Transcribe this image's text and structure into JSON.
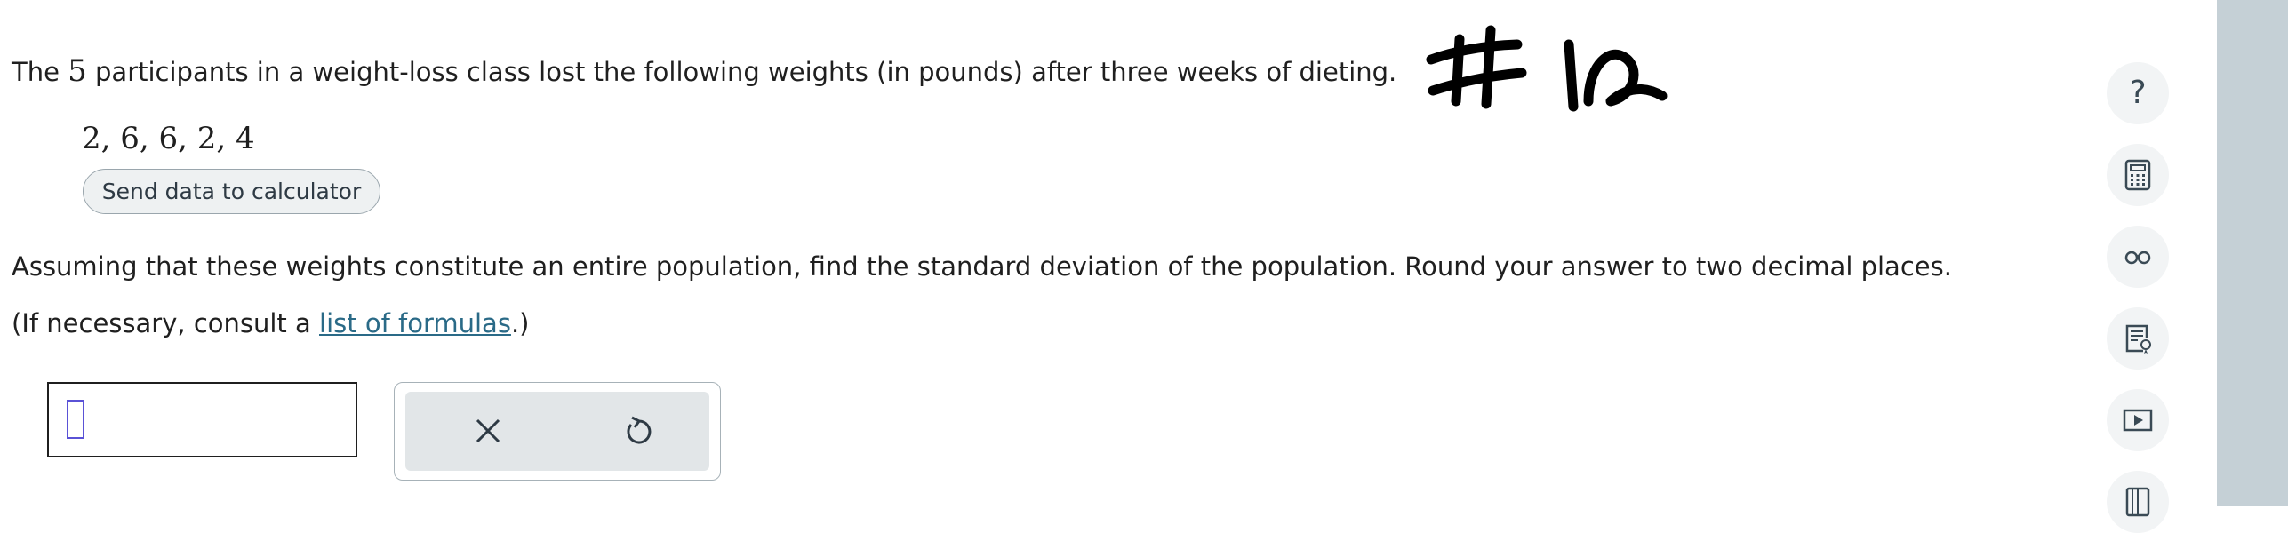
{
  "question": {
    "intro_before": "The",
    "participant_count": "5",
    "intro_after": "participants in a weight-loss class lost the following weights (in pounds) after three weeks of dieting.",
    "data_values": "2, 6, 6, 2, 4",
    "send_button_label": "Send data to calculator",
    "instruction": "Assuming that these weights constitute an entire population, find the standard deviation of the population. Round your answer to two decimal places.",
    "consult_before": "(If necessary, consult a",
    "consult_link": "list of formulas",
    "consult_after": ".)"
  },
  "answer": {
    "value": ""
  },
  "handwriting_note": "#12",
  "tool_panel": {
    "icons": [
      "close-icon",
      "undo-icon"
    ]
  },
  "sidebar": {
    "help_glyph": "?",
    "items": [
      "help-icon",
      "calculator-icon",
      "glasses-icon",
      "checklist-icon",
      "video-icon",
      "book-icon"
    ]
  },
  "colors": {
    "link": "#2a6a87",
    "caret": "#5a52d6",
    "right_bar": "#c5d0d6",
    "send_button_bg": "#eef1f2",
    "tool_bg": "#e2e6e8"
  }
}
